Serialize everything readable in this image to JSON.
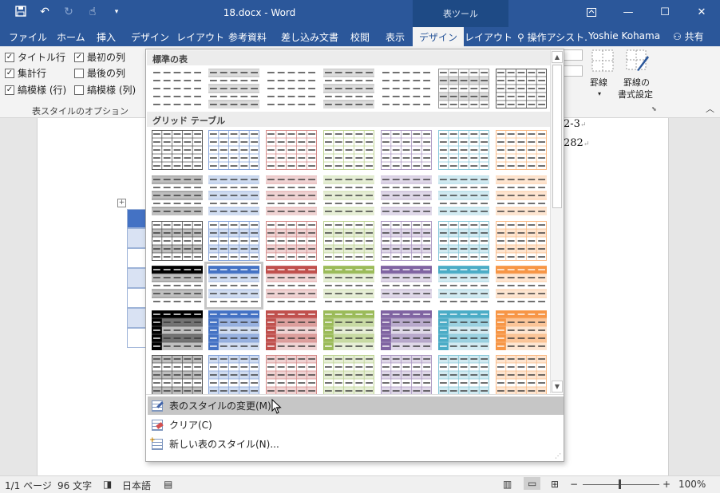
{
  "titlebar": {
    "title": "18.docx - Word",
    "contextual_tab": "表ツール",
    "qat": [
      "save-icon",
      "undo-icon",
      "redo-icon",
      "touch-mode-icon",
      "customize-icon"
    ],
    "window_buttons": [
      "ribbon-display-icon",
      "minimize-icon",
      "maximize-icon",
      "close-icon"
    ]
  },
  "tabs": [
    "ファイル",
    "ホーム",
    "挿入",
    "デザイン",
    "レイアウト",
    "参考資料",
    "差し込み文書",
    "校閲",
    "表示",
    "デザイン",
    "レイアウト"
  ],
  "active_tab": "デザイン",
  "tell_me": "操作アシスト.",
  "user": "Yoshie Kohama",
  "share": "共有",
  "options": {
    "group_label": "表スタイルのオプション",
    "items": [
      {
        "label": "タイトル行",
        "checked": true
      },
      {
        "label": "最初の列",
        "checked": true
      },
      {
        "label": "集計行",
        "checked": true
      },
      {
        "label": "最後の列",
        "checked": false
      },
      {
        "label": "縞模様 (行)",
        "checked": true
      },
      {
        "label": "縞模様 (列)",
        "checked": false
      }
    ]
  },
  "ribbon_right": {
    "borders_label": "罫線",
    "border_painter_label_1": "罫線の",
    "border_painter_label_2": "書式設定"
  },
  "document": {
    "line1": "2-3",
    "line2": "282"
  },
  "gallery": {
    "section_plain": "標準の表",
    "section_grid": "グリッド テーブル",
    "colors": [
      "#000000",
      "#4472c4",
      "#c0504d",
      "#9bbb59",
      "#8064a2",
      "#4bacc6",
      "#f79646"
    ],
    "footer": [
      {
        "label": "表のスタイルの変更(M)...",
        "icon": "modify-style-icon",
        "highlighted": true
      },
      {
        "label": "クリア(C)",
        "icon": "clear-icon",
        "highlighted": false
      },
      {
        "label": "新しい表のスタイル(N)...",
        "icon": "new-style-icon",
        "highlighted": false
      }
    ]
  },
  "status": {
    "page": "1/1 ページ",
    "words": "96 文字",
    "language": "日本語",
    "zoom": "100%"
  }
}
